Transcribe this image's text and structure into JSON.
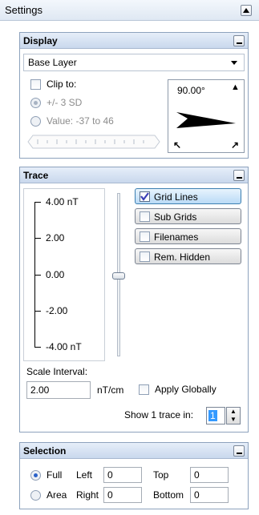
{
  "window": {
    "title": "Settings"
  },
  "display": {
    "title": "Display",
    "layer": "Base Layer",
    "clip_label": "Clip to:",
    "option_sd": "+/- 3 SD",
    "option_value": "Value: -37 to 46",
    "angle": "90.00°"
  },
  "trace": {
    "title": "Trace",
    "scale_labels": [
      "4.00 nT",
      "2.00",
      "0.00",
      "-2.00",
      "-4.00 nT"
    ],
    "buttons": [
      "Grid Lines",
      "Sub Grids",
      "Filenames",
      "Rem. Hidden"
    ],
    "scale_interval_label": "Scale Interval:",
    "scale_interval_value": "2.00",
    "unit": "nT/cm",
    "apply_globally": "Apply Globally",
    "show_trace_label": "Show 1 trace in:",
    "show_trace_value": "1"
  },
  "selection": {
    "title": "Selection",
    "full": "Full",
    "area": "Area",
    "left_label": "Left",
    "left_value": "0",
    "right_label": "Right",
    "right_value": "0",
    "top_label": "Top",
    "top_value": "0",
    "bottom_label": "Bottom",
    "bottom_value": "0"
  }
}
